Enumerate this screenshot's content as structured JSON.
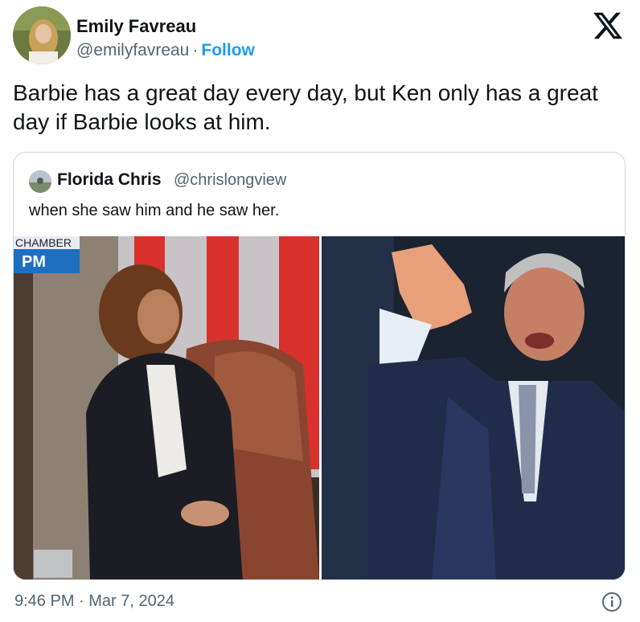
{
  "author": {
    "name": "Emily Favreau",
    "handle": "@emilyfavreau",
    "separator": "·",
    "follow_label": "Follow"
  },
  "tweet": {
    "text": "Barbie has a great day every day, but Ken only has a great day if Barbie looks at him.",
    "timestamp": "9:46 PM · Mar 7, 2024"
  },
  "quoted_tweet": {
    "name": "Florida Chris",
    "handle": "@chrislongview",
    "text": "when she saw him and he saw her.",
    "media_overlay": {
      "line1": "CHAMBER",
      "line2": "PM"
    }
  },
  "icons": {
    "brand": "x-logo-icon",
    "info": "info-icon"
  },
  "colors": {
    "follow": "#1d9bf0",
    "secondary_text": "#536471",
    "border": "#cfd9de"
  }
}
